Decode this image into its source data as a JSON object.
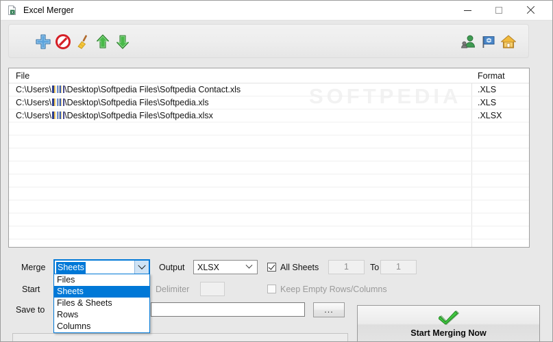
{
  "window": {
    "title": "Excel Merger",
    "app_icon": "excel-document-icon",
    "controls": {
      "minimize": "minimize-icon",
      "maximize": "maximize-icon",
      "close": "close-icon"
    }
  },
  "toolbar": {
    "left_buttons": [
      {
        "name": "add-files-button",
        "icon": "blue-plus-icon"
      },
      {
        "name": "remove-file-button",
        "icon": "red-prohibition-icon"
      },
      {
        "name": "clear-list-button",
        "icon": "broom-icon"
      },
      {
        "name": "move-up-button",
        "icon": "green-up-arrow-icon"
      },
      {
        "name": "move-down-button",
        "icon": "green-down-arrow-icon"
      }
    ],
    "right_buttons": [
      {
        "name": "user-button",
        "icon": "user-icon"
      },
      {
        "name": "feedback-button",
        "icon": "flag-icon"
      },
      {
        "name": "home-button",
        "icon": "home-icon"
      }
    ]
  },
  "filelist": {
    "columns": [
      "File",
      "Format"
    ],
    "rows": [
      {
        "file_prefix": "C:\\Users\\",
        "file_suffix": "\\Desktop\\Softpedia Files\\Softpedia Contact.xls",
        "format": ".XLS"
      },
      {
        "file_prefix": "C:\\Users\\",
        "file_suffix": "\\Desktop\\Softpedia Files\\Softpedia.xls",
        "format": ".XLS"
      },
      {
        "file_prefix": "C:\\Users\\",
        "file_suffix": "\\Desktop\\Softpedia Files\\Softpedia.xlsx",
        "format": ".XLSX"
      }
    ],
    "empty_row_count": 11,
    "watermark": "SOFTPEDIA"
  },
  "controls": {
    "merge_label": "Merge",
    "merge_value": "Sheets",
    "merge_options": [
      "Files",
      "Sheets",
      "Files & Sheets",
      "Rows",
      "Columns"
    ],
    "merge_selected_index": 1,
    "output_label": "Output",
    "output_value": "XLSX",
    "all_sheets_label": "All Sheets",
    "all_sheets_checked": true,
    "sheet_from": "1",
    "to_label": "To",
    "sheet_to": "1",
    "start_label": "Start",
    "delimiter_label": "Delimiter",
    "delimiter_value": "",
    "keep_empty_label": "Keep Empty Rows/Columns",
    "keep_empty_checked": false,
    "save_to_label": "Save to",
    "save_to_value": "",
    "browse_label": "...",
    "start_button_label": "Start Merging Now",
    "start_button_icon": "green-check-icon"
  },
  "colors": {
    "accent": "#0078d7",
    "window_bg": "#e8e8e8",
    "list_bg": "#ffffff",
    "disabled_text": "#9a9a9a"
  }
}
